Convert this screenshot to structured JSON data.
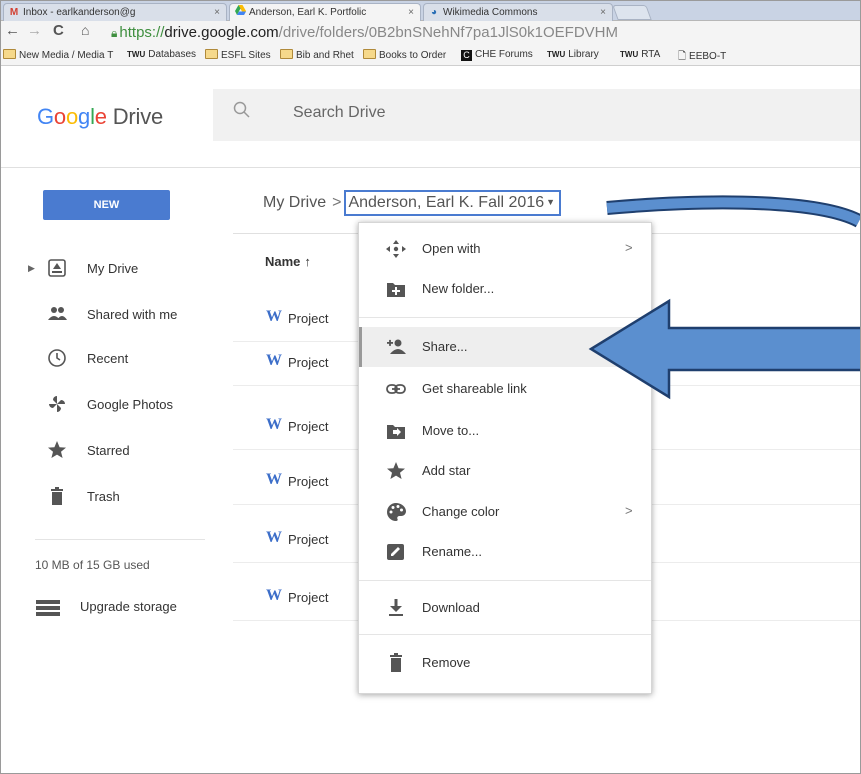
{
  "browser": {
    "tabs": [
      {
        "label": "Inbox - earlkanderson@g",
        "icon": "gmail-icon",
        "active": false
      },
      {
        "label": "Anderson, Earl K. Portfolic",
        "icon": "drive-icon",
        "active": true
      },
      {
        "label": "Wikimedia Commons",
        "icon": "wikimedia-icon",
        "active": false
      }
    ],
    "tab_close": "×",
    "url": {
      "protocol": "https://",
      "host": "drive.google.com",
      "path": "/drive/folders/0B2bnSNehNf7pa1JlS0k1OEFDVHM"
    },
    "bookmarks": [
      {
        "label": "New Media / Media T",
        "kind": "folder"
      },
      {
        "label": "Databases",
        "kind": "twu"
      },
      {
        "label": "ESFL Sites",
        "kind": "folder"
      },
      {
        "label": "Bib and Rhet",
        "kind": "folder"
      },
      {
        "label": "Books to Order",
        "kind": "folder"
      },
      {
        "label": "CHE Forums",
        "kind": "che"
      },
      {
        "label": "Library",
        "kind": "twu"
      },
      {
        "label": "RTA",
        "kind": "twu"
      },
      {
        "label": "EEBO-T",
        "kind": "page"
      }
    ],
    "twu_badge": "TWU"
  },
  "drive": {
    "logo_google": "Google",
    "logo_product": "Drive",
    "search_placeholder": "Search Drive",
    "new_button": "NEW",
    "breadcrumb": {
      "root": "My Drive",
      "separator": ">",
      "current": "Anderson, Earl K. Fall 2016"
    }
  },
  "sidebar": {
    "items": [
      {
        "label": "My Drive",
        "icon": "drive-folder-icon"
      },
      {
        "label": "Shared with me",
        "icon": "people-icon"
      },
      {
        "label": "Recent",
        "icon": "clock-icon"
      },
      {
        "label": "Google Photos",
        "icon": "pinwheel-icon"
      },
      {
        "label": "Starred",
        "icon": "star-icon"
      },
      {
        "label": "Trash",
        "icon": "trash-icon"
      }
    ],
    "storage": "10 MB of 15 GB used",
    "upgrade": "Upgrade storage"
  },
  "list": {
    "column_name": "Name",
    "sort_arrow": "↑",
    "files": [
      {
        "name": "Project"
      },
      {
        "name": "Project"
      },
      {
        "name": "Project"
      },
      {
        "name": "Project"
      },
      {
        "name": "Project"
      },
      {
        "name": "Project"
      }
    ]
  },
  "menu": {
    "items": [
      {
        "label": "Open with",
        "icon": "open-with-icon",
        "submenu": ">"
      },
      {
        "label": "New folder...",
        "icon": "new-folder-icon",
        "submenu": ""
      },
      {
        "label": "Share...",
        "icon": "share-icon",
        "submenu": "",
        "highlighted": true
      },
      {
        "label": "Get shareable link",
        "icon": "link-icon",
        "submenu": ""
      },
      {
        "label": "Move to...",
        "icon": "move-to-icon",
        "submenu": ""
      },
      {
        "label": "Add star",
        "icon": "star-icon",
        "submenu": ""
      },
      {
        "label": "Change color",
        "icon": "palette-icon",
        "submenu": ">"
      },
      {
        "label": "Rename...",
        "icon": "rename-icon",
        "submenu": ""
      },
      {
        "label": "Download",
        "icon": "download-icon",
        "submenu": ""
      },
      {
        "label": "Remove",
        "icon": "trash-icon",
        "submenu": ""
      }
    ]
  },
  "colors": {
    "accent": "#4a7bd0",
    "annotation_arrow": "#5b8fcf",
    "annotation_outline": "#1f3f6e"
  }
}
